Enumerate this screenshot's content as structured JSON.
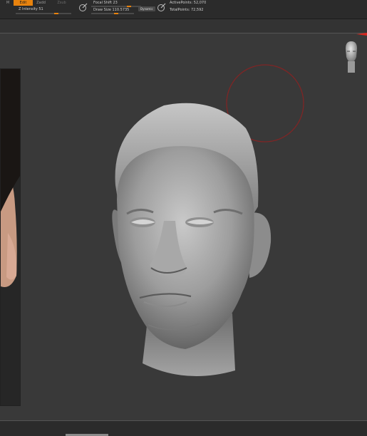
{
  "toolbar": {
    "mode_buttons": [
      {
        "label": "M",
        "active": false
      },
      {
        "label": "Edit",
        "active": true
      },
      {
        "label": "Zadd",
        "active": false
      },
      {
        "label": "Zsub",
        "active": false
      }
    ],
    "z_intensity_label": "Z Intensity 51",
    "focal_shift_label": "Focal Shift 23",
    "draw_size_label": "Draw Size 110.5735",
    "dynamic_label": "Dynamic",
    "active_points_label": "ActivePoints: 52,070",
    "total_points_label": "TotalPoints: 72,592"
  },
  "colors": {
    "accent": "#e8830e",
    "canvas": "#393939",
    "toolbar": "#2b2b2b",
    "brush_cursor": "#b02020"
  },
  "icons": {
    "brush_icon": "brush-settings-icon",
    "points_icon": "points-icon",
    "navigation_head": "navigation-head-icon"
  }
}
